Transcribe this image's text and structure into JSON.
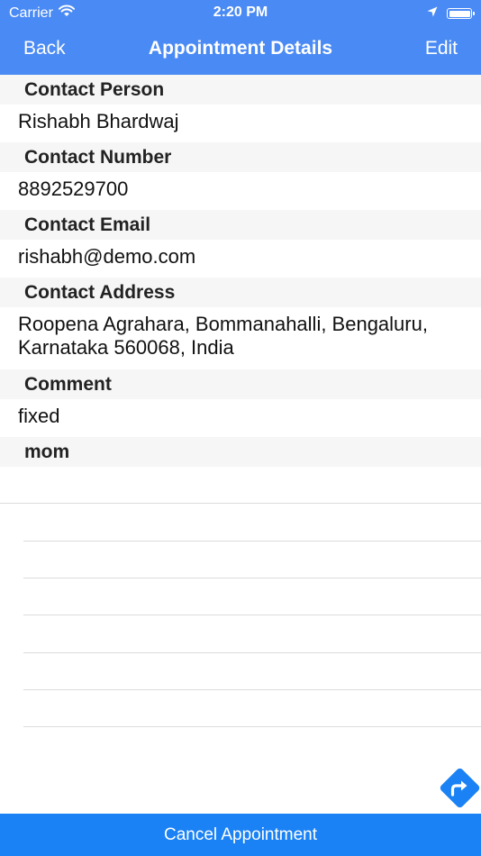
{
  "status_bar": {
    "carrier": "Carrier",
    "time": "2:20 PM",
    "wifi_icon": "wifi-icon",
    "location_icon": "location-arrow-icon",
    "battery_icon": "battery-icon"
  },
  "nav": {
    "back_label": "Back",
    "title": "Appointment Details",
    "edit_label": "Edit"
  },
  "details": {
    "contact_person": {
      "label": "Contact Person",
      "value": "Rishabh Bhardwaj"
    },
    "contact_number": {
      "label": "Contact Number",
      "value": "8892529700"
    },
    "contact_email": {
      "label": "Contact Email",
      "value": "rishabh@demo.com"
    },
    "contact_address": {
      "label": "Contact Address",
      "value_line1": "Roopena Agrahara, Bommanahalli, Bengaluru,",
      "value_line2": "Karnataka 560068, India"
    },
    "comment": {
      "label": "Comment",
      "value": "fixed"
    },
    "mom": {
      "label": "mom"
    }
  },
  "fab": {
    "icon": "directions-icon",
    "color": "#1a82f4"
  },
  "footer": {
    "cancel_label": "Cancel Appointment"
  },
  "colors": {
    "nav_background": "#4a8af4",
    "footer_background": "#1a82f4",
    "section_header_background": "#f6f6f6"
  }
}
